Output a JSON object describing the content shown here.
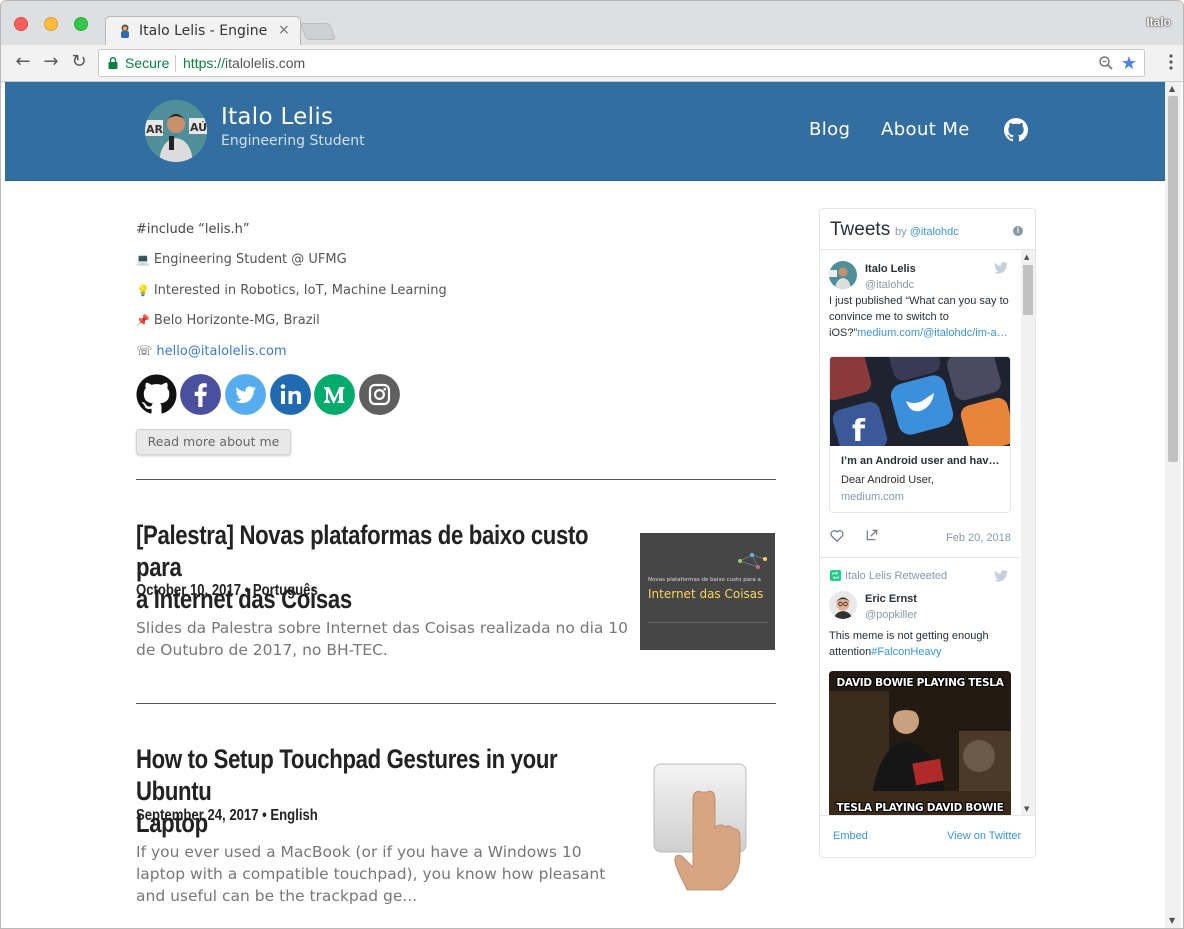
{
  "browser": {
    "tab_title": "Italo Lelis - Engineer",
    "tab_close": "×",
    "profile_name": "Italo",
    "secure_label": "Secure",
    "url_scheme": "https://",
    "url_host": "italolelis.com",
    "back_glyph": "←",
    "forward_glyph": "→",
    "reload_glyph": "↻",
    "star_glyph": "★"
  },
  "header": {
    "site_name": "Italo Lelis",
    "tagline": "Engineering Student",
    "nav": [
      {
        "label": "Blog"
      },
      {
        "label": "About Me"
      }
    ],
    "accent_color": "#336ea1"
  },
  "intro": {
    "include_line": "#include “lelis.h”",
    "lines": [
      {
        "icon": "💻",
        "text": "Engineering Student @ UFMG"
      },
      {
        "icon": "💡",
        "text": "Interested in Robotics, IoT, Machine Learning"
      },
      {
        "icon": "📌",
        "text": "Belo Horizonte-MG, Brazil"
      },
      {
        "icon": "☏",
        "text": "hello@italolelis.com"
      }
    ],
    "social": [
      "github-icon",
      "facebook-icon",
      "twitter-icon",
      "linkedin-icon",
      "medium-icon",
      "instagram-icon"
    ],
    "read_more_label": "Read more about me"
  },
  "posts": [
    {
      "title_line1": "[Palestra] Novas plataformas de baixo custo para",
      "title_line2": "a Internet das Coisas",
      "meta": "October 10, 2017 • Português",
      "excerpt": "Slides da Palestra sobre Internet das Coisas realizada no dia 10 de Outubro de 2017, no BH-TEC.",
      "thumb_small": "Novas plataformas de baixo custo para a",
      "thumb_big": "Internet das Coisas"
    },
    {
      "title_line1": "How to Setup Touchpad Gestures in your Ubuntu",
      "title_line2": "Laptop",
      "meta": "September 24, 2017 • English",
      "excerpt": "If you ever used a MacBook (or if you have a Windows 10 laptop with a compatible touchpad), you know how pleasant and useful can be the trackpad ge..."
    }
  ],
  "twitter": {
    "title": "Tweets",
    "by_prefix": "by ",
    "by_handle": "@italohdc",
    "info_glyph": "i",
    "tweet1": {
      "name": "Italo Lelis",
      "handle": "@italohdc",
      "text": "I just published “What can you say to convince me to switch to iOS?”",
      "link": "medium.com/@italohdc/im-a…",
      "card_title": "I’m an Android user and hav…",
      "card_desc": "Dear Android User,",
      "card_domain": "medium.com",
      "date": "Feb 20, 2018"
    },
    "tweet2": {
      "retweet_label": "Italo Lelis Retweeted",
      "name": "Eric Ernst",
      "handle": "@popkiller",
      "text": "This meme is not getting enough attention",
      "hashtag": "#FalconHeavy",
      "meme_top": "DAVID BOWIE PLAYING TESLA",
      "meme_bottom": "TESLA PLAYING DAVID BOWIE"
    },
    "embed_label": "Embed",
    "view_label": "View on Twitter"
  }
}
